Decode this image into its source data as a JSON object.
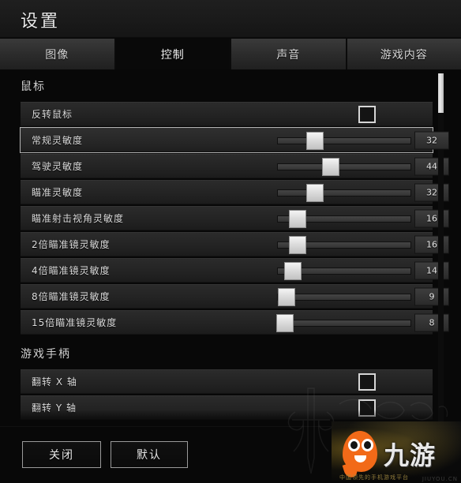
{
  "header": {
    "title": "设置"
  },
  "tabs": [
    {
      "label": "图像",
      "active": false
    },
    {
      "label": "控制",
      "active": true
    },
    {
      "label": "声音",
      "active": false
    },
    {
      "label": "游戏内容",
      "active": false
    }
  ],
  "sections": [
    {
      "title": "鼠标",
      "rows": [
        {
          "label": "反转鼠标",
          "type": "checkbox",
          "checked": false,
          "selected": false
        },
        {
          "label": "常规灵敏度",
          "type": "slider",
          "value": 32,
          "max": 100,
          "percent": 28,
          "selected": true
        },
        {
          "label": "驾驶灵敏度",
          "type": "slider",
          "value": 44,
          "max": 100,
          "percent": 40,
          "selected": false
        },
        {
          "label": "瞄准灵敏度",
          "type": "slider",
          "value": 32,
          "max": 100,
          "percent": 28,
          "selected": false
        },
        {
          "label": "瞄准射击视角灵敏度",
          "type": "slider",
          "value": 16,
          "max": 100,
          "percent": 15,
          "selected": false
        },
        {
          "label": "2倍瞄准镜灵敏度",
          "type": "slider",
          "value": 16,
          "max": 100,
          "percent": 15,
          "selected": false
        },
        {
          "label": "4倍瞄准镜灵敏度",
          "type": "slider",
          "value": 14,
          "max": 100,
          "percent": 12,
          "selected": false
        },
        {
          "label": "8倍瞄准镜灵敏度",
          "type": "slider",
          "value": 9,
          "max": 100,
          "percent": 7,
          "selected": false
        },
        {
          "label": "15倍瞄准镜灵敏度",
          "type": "slider",
          "value": 8,
          "max": 100,
          "percent": 6,
          "selected": false
        }
      ]
    },
    {
      "title": "游戏手柄",
      "rows": [
        {
          "label": "翻转 X 轴",
          "type": "checkbox",
          "checked": false,
          "selected": false
        },
        {
          "label": "翻转 Y 轴",
          "type": "checkbox",
          "checked": false,
          "selected": false
        }
      ]
    }
  ],
  "scrollbar": {
    "thumb_top_pct": 0.8,
    "thumb_height_pct": 11
  },
  "footer": {
    "close_label": "关闭",
    "default_label": "默认"
  },
  "watermark": {
    "brand": "九游",
    "tagline": "中国领先的手机游戏平台",
    "corner_text": "JIUYOU.CN"
  },
  "colors": {
    "accent_orange": "#f26a18",
    "panel_bg": "#080808",
    "row_bg": "#242424",
    "text": "#dcdcdc"
  }
}
